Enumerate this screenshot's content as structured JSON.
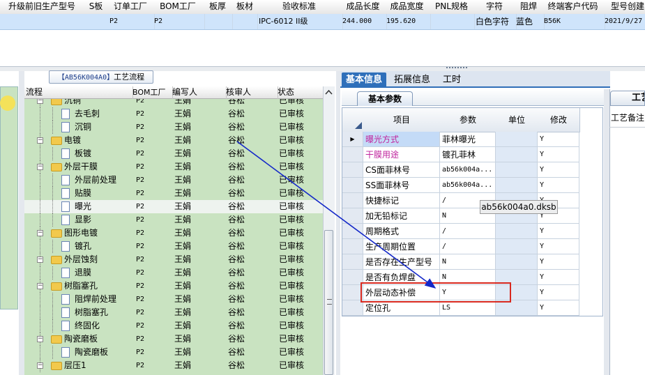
{
  "top_grid": {
    "columns": [
      "升级前旧生产型号",
      "S板",
      "订单工厂",
      "BOM工厂",
      "板厚",
      "板材",
      "验收标准",
      "成品长度",
      "成品宽度",
      "PNL规格",
      "字符",
      "阻焊",
      "终端客户代码",
      "型号创建"
    ],
    "row": {
      "order_factory": "P2",
      "bom_factory": "P2",
      "standard": "IPC-6012 II级",
      "length": "244.000",
      "width": "195.620",
      "char": "白色字符",
      "mask": "蓝色",
      "customer": "B56K",
      "created": "2021/9/27"
    }
  },
  "workflow": {
    "tab_prefix": "【AB56K004A0】",
    "tab_title": "工艺流程",
    "headers": [
      "流程",
      "BOM工厂",
      "编写人",
      "核审人",
      "状态"
    ],
    "rows": [
      {
        "name": "沉铜",
        "level": 0,
        "bom": "P2",
        "writer": "王娟",
        "reviewer": "谷松",
        "status": "已审核"
      },
      {
        "name": "去毛刺",
        "level": 1,
        "bom": "P2",
        "writer": "王娟",
        "reviewer": "谷松",
        "status": "已审核"
      },
      {
        "name": "沉铜",
        "level": 1,
        "bom": "P2",
        "writer": "王娟",
        "reviewer": "谷松",
        "status": "已审核"
      },
      {
        "name": "电镀",
        "level": 0,
        "bom": "P2",
        "writer": "王娟",
        "reviewer": "谷松",
        "status": "已审核"
      },
      {
        "name": "板镀",
        "level": 1,
        "bom": "P2",
        "writer": "王娟",
        "reviewer": "谷松",
        "status": "已审核"
      },
      {
        "name": "外层干膜",
        "level": 0,
        "bom": "P2",
        "writer": "王娟",
        "reviewer": "谷松",
        "status": "已审核"
      },
      {
        "name": "外层前处理",
        "level": 1,
        "bom": "P2",
        "writer": "王娟",
        "reviewer": "谷松",
        "status": "已审核"
      },
      {
        "name": "贴膜",
        "level": 1,
        "bom": "P2",
        "writer": "王娟",
        "reviewer": "谷松",
        "status": "已审核"
      },
      {
        "name": "曝光",
        "level": 1,
        "bom": "P2",
        "writer": "王娟",
        "reviewer": "谷松",
        "status": "已审核",
        "selected": true
      },
      {
        "name": "显影",
        "level": 1,
        "bom": "P2",
        "writer": "王娟",
        "reviewer": "谷松",
        "status": "已审核"
      },
      {
        "name": "图形电镀",
        "level": 0,
        "bom": "P2",
        "writer": "王娟",
        "reviewer": "谷松",
        "status": "已审核"
      },
      {
        "name": "镀孔",
        "level": 1,
        "bom": "P2",
        "writer": "王娟",
        "reviewer": "谷松",
        "status": "已审核"
      },
      {
        "name": "外层蚀刻",
        "level": 0,
        "bom": "P2",
        "writer": "王娟",
        "reviewer": "谷松",
        "status": "已审核"
      },
      {
        "name": "退膜",
        "level": 1,
        "bom": "P2",
        "writer": "王娟",
        "reviewer": "谷松",
        "status": "已审核"
      },
      {
        "name": "树脂塞孔",
        "level": 0,
        "bom": "P2",
        "writer": "王娟",
        "reviewer": "谷松",
        "status": "已审核"
      },
      {
        "name": "阻焊前处理",
        "level": 1,
        "bom": "P2",
        "writer": "王娟",
        "reviewer": "谷松",
        "status": "已审核"
      },
      {
        "name": "树脂塞孔",
        "level": 1,
        "bom": "P2",
        "writer": "王娟",
        "reviewer": "谷松",
        "status": "已审核"
      },
      {
        "name": "终固化",
        "level": 1,
        "bom": "P2",
        "writer": "王娟",
        "reviewer": "谷松",
        "status": "已审核"
      },
      {
        "name": "陶瓷磨板",
        "level": 0,
        "bom": "P2",
        "writer": "王娟",
        "reviewer": "谷松",
        "status": "已审核"
      },
      {
        "name": "陶瓷磨板",
        "level": 1,
        "bom": "P2",
        "writer": "王娟",
        "reviewer": "谷松",
        "status": "已审核"
      },
      {
        "name": "层压1",
        "level": 0,
        "bom": "P2",
        "writer": "王娟",
        "reviewer": "谷松",
        "status": "已审核"
      }
    ]
  },
  "right_tabs": [
    "基本信息",
    "拓展信息",
    "工时"
  ],
  "sub_tab": "基本参数",
  "param_headers": [
    "项目",
    "参数",
    "单位",
    "修改"
  ],
  "params": [
    {
      "item": "曝光方式",
      "value": "菲林曝光",
      "mod": "Y",
      "pink": true,
      "blue": true,
      "current": true
    },
    {
      "item": "干膜用途",
      "value": "镀孔菲林",
      "mod": "Y",
      "pink": true
    },
    {
      "item": "CS面菲林号",
      "value": "ab56k004a...",
      "mod": "Y"
    },
    {
      "item": "SS面菲林号",
      "value": "ab56k004a...",
      "mod": "Y"
    },
    {
      "item": "快捷标记",
      "value": "/",
      "mod": "Y"
    },
    {
      "item": "加无铅标记",
      "value": "N",
      "mod": "Y"
    },
    {
      "item": "周期格式",
      "value": "/",
      "mod": "Y"
    },
    {
      "item": "生产周期位置",
      "value": "/",
      "mod": "Y"
    },
    {
      "item": "是否存在生产型号",
      "value": "N",
      "mod": "Y"
    },
    {
      "item": "是否有负焊盘",
      "value": "N",
      "mod": "Y"
    },
    {
      "item": "外层动态补偿",
      "value": "Y",
      "mod": "Y"
    },
    {
      "item": "定位孔",
      "value": "LS",
      "mod": "Y"
    }
  ],
  "tooltip": "ab56k004a0.dksb",
  "far_panel": {
    "tab": "工艺",
    "label": "工艺备注"
  },
  "colors": {
    "tree_bg": "#c9e3c1",
    "selected_row": "#cfe4fb",
    "tab_active": "#2e6fba",
    "pink_text": "#c0259e",
    "highlight_border": "#d8291f",
    "arrow": "#1428c8"
  }
}
